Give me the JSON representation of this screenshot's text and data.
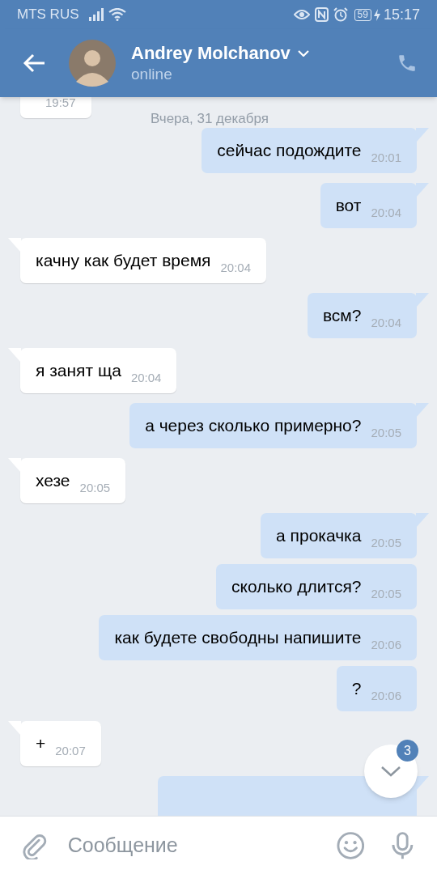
{
  "status_bar": {
    "carrier": "MTS RUS",
    "battery": "59",
    "time": "15:17"
  },
  "header": {
    "name": "Andrey Molchanov",
    "status": "online"
  },
  "date_separator": "Вчера, 31 декабря",
  "messages": [
    {
      "kind": "incoming",
      "time": "19:57",
      "tail": false
    },
    {
      "kind": "outgoing",
      "text": "сейчас подождите",
      "time": "20:01",
      "tail": true
    },
    {
      "kind": "outgoing",
      "text": "вот",
      "time": "20:04",
      "tail": true
    },
    {
      "kind": "incoming",
      "text": "качну как будет время",
      "time": "20:04",
      "tail": true
    },
    {
      "kind": "outgoing",
      "text": "всм?",
      "time": "20:04",
      "tail": true
    },
    {
      "kind": "incoming",
      "text": "я занят ща",
      "time": "20:04",
      "tail": true
    },
    {
      "kind": "outgoing",
      "text": "а через сколько примерно?",
      "time": "20:05",
      "tail": true
    },
    {
      "kind": "incoming",
      "text": "хезе",
      "time": "20:05",
      "tail": true
    },
    {
      "kind": "outgoing",
      "text": "а прокачка",
      "time": "20:05",
      "tail": true
    },
    {
      "kind": "outgoing",
      "text": "сколько длится?",
      "time": "20:05",
      "tail": false
    },
    {
      "kind": "outgoing",
      "text": "как будете свободны напишите",
      "time": "20:06",
      "tail": false
    },
    {
      "kind": "outgoing",
      "text": "?",
      "time": "20:06",
      "tail": false
    },
    {
      "kind": "incoming",
      "text": "+",
      "time": "20:07",
      "tail": true
    },
    {
      "kind": "outgoing",
      "tail": true
    }
  ],
  "scroll_button": {
    "badge": "3"
  },
  "composer": {
    "placeholder": "Сообщение"
  }
}
